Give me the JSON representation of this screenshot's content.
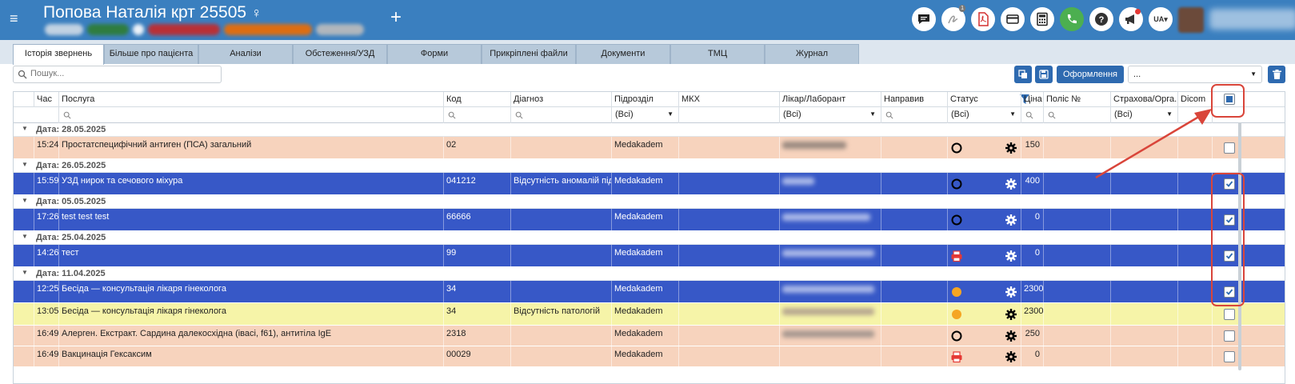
{
  "header": {
    "patient_title": "Попова Наталія крт 25505",
    "gender_symbol": "♀",
    "menu_icon": "hamburger-icon",
    "add_icon": "plus-icon",
    "notification_count": "1",
    "lang_label": "UA▾",
    "badge_colors": [
      "#2e7d32",
      "#c62828",
      "#ef6c00",
      "#9e9e9e"
    ]
  },
  "tabs": [
    {
      "label": "Історія звернень",
      "active": true
    },
    {
      "label": "Більше про пацієнта"
    },
    {
      "label": "Аналізи"
    },
    {
      "label": "Обстеження/УЗД"
    },
    {
      "label": "Форми"
    },
    {
      "label": "Прикріплені файли"
    },
    {
      "label": "Документи"
    },
    {
      "label": "ТМЦ"
    },
    {
      "label": "Журнал"
    }
  ],
  "toolbar": {
    "search_placeholder": "Пошук...",
    "form_button": "Оформлення",
    "select_value": "..."
  },
  "columns": {
    "time": "Час",
    "service": "Послуга",
    "code": "Код",
    "diagnosis": "Діагноз",
    "department": "Підрозділ",
    "mkh": "МКХ",
    "doctor": "Лікар/Лаборант",
    "referred": "Направив",
    "status": "Статус",
    "price": "Ціна",
    "policy": "Поліс №",
    "insurer": "Страхова/Орга...",
    "dicom": "Dicom"
  },
  "filters": {
    "department": "(Всі)",
    "doctor": "(Всі)",
    "status": "(Всі)",
    "insurer": "(Всі)"
  },
  "groups": [
    {
      "label": "Дата: 28.05.2025"
    },
    {
      "label": "Дата: 26.05.2025"
    },
    {
      "label": "Дата: 05.05.2025"
    },
    {
      "label": "Дата: 25.04.2025"
    },
    {
      "label": "Дата: 11.04.2025"
    }
  ],
  "rows": [
    {
      "time": "15:24",
      "service": "Простатспецифічний антиген (ПСА) загальний",
      "code": "02",
      "diagnosis": "",
      "department": "Medakadem",
      "price": "150",
      "status": "circle-empty",
      "color": "orange",
      "checked": false
    },
    {
      "time": "15:59",
      "service": "УЗД нирок та сечового міхура",
      "code": "041212",
      "diagnosis": "Відсутність аномалій під...",
      "department": "Medakadem",
      "price": "400",
      "status": "circle-empty",
      "color": "blue",
      "checked": true
    },
    {
      "time": "17:26",
      "service": "test test test",
      "code": "66666",
      "diagnosis": "",
      "department": "Medakadem",
      "price": "0",
      "status": "circle-empty",
      "color": "blue",
      "checked": true
    },
    {
      "time": "14:26",
      "service": "тест",
      "code": "99",
      "diagnosis": "",
      "department": "Medakadem",
      "price": "0",
      "status": "printer",
      "color": "blue",
      "checked": true
    },
    {
      "time": "12:25",
      "service": "Бесіда — консультація  лікаря гінеколога",
      "code": "34",
      "diagnosis": "",
      "department": "Medakadem",
      "price": "2300",
      "status": "circle-orange",
      "color": "blue",
      "checked": true
    },
    {
      "time": "13:05",
      "service": "Бесіда — консультація  лікаря гінеколога",
      "code": "34",
      "diagnosis": "Відсутність патологій",
      "department": "Medakadem",
      "price": "2300",
      "status": "circle-orange",
      "color": "yellow",
      "checked": false
    },
    {
      "time": "16:49",
      "service": "Алерген. Екстракт. Сардина далекосхідна (івасі, f61), антитіла IgE",
      "code": "2318",
      "diagnosis": "",
      "department": "Medakadem",
      "price": "250",
      "status": "circle-empty",
      "color": "orange",
      "checked": false
    },
    {
      "time": "16:49",
      "service": "Вакцинація Гексаксим",
      "code": "00029",
      "diagnosis": "",
      "department": "Medakadem",
      "price": "0",
      "status": "printer",
      "color": "orange",
      "checked": false
    }
  ],
  "annotation_color": "#d9453a"
}
